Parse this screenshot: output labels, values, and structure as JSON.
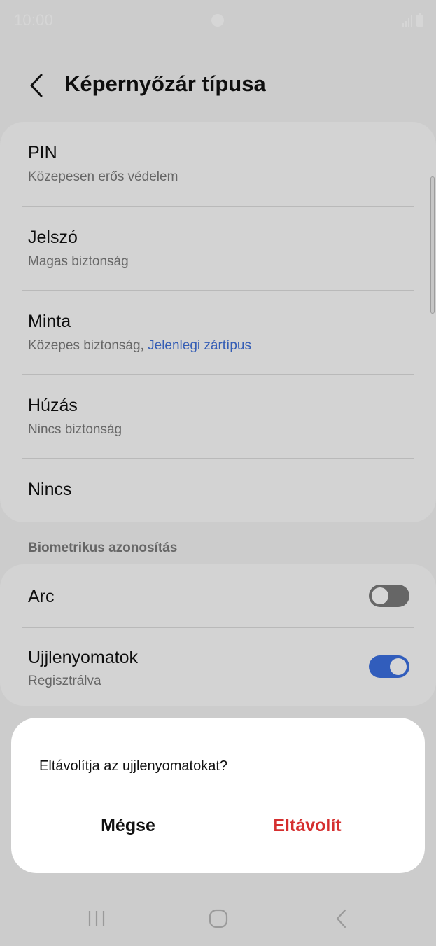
{
  "status_bar": {
    "time": "10:00"
  },
  "header": {
    "title": "Képernyőzár típusa"
  },
  "lock_types": [
    {
      "title": "PIN",
      "subtitle": "Közepesen erős védelem"
    },
    {
      "title": "Jelszó",
      "subtitle": "Magas biztonság"
    },
    {
      "title": "Minta",
      "subtitle": "Közepes biztonság, ",
      "highlight": "Jelenlegi zártípus"
    },
    {
      "title": "Húzás",
      "subtitle": "Nincs biztonság"
    },
    {
      "title": "Nincs"
    }
  ],
  "biometrics": {
    "section_title": "Biometrikus azonosítás",
    "face": {
      "title": "Arc",
      "enabled": false
    },
    "fingerprints": {
      "title": "Ujjlenyomatok",
      "subtitle": "Regisztrálva",
      "enabled": true
    }
  },
  "dialog": {
    "message": "Eltávolítja az ujjlenyomatokat?",
    "cancel_label": "Mégse",
    "remove_label": "Eltávolít"
  },
  "colors": {
    "accent": "#3b6fe0",
    "destructive": "#d52f2f",
    "link": "#3f6fd8"
  },
  "icons": {
    "back": "back-chevron-icon",
    "nav_recents": "recents-icon",
    "nav_home": "home-icon",
    "nav_back": "nav-back-icon"
  }
}
